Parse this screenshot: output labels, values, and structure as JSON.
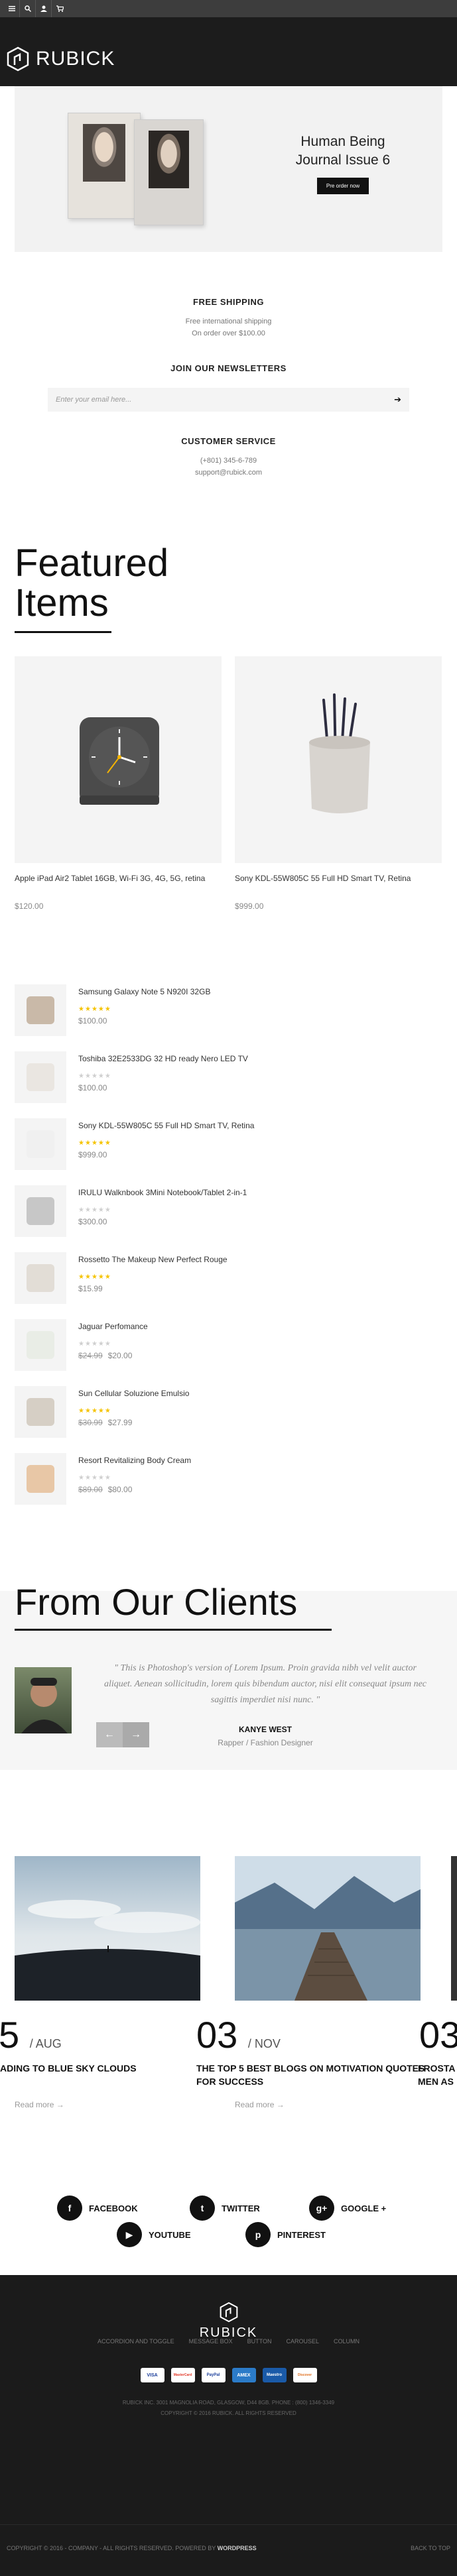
{
  "topbar": {
    "icons": [
      "menu-icon",
      "search-icon",
      "user-icon",
      "cart-icon"
    ]
  },
  "header": {
    "brand": "RUBICK"
  },
  "banner": {
    "title_line1": "Human Being",
    "title_line2": "Journal Issue 6",
    "button": "Pre order now"
  },
  "shipping": {
    "title": "FREE SHIPPING",
    "line1": "Free international shipping",
    "line2": "On order over $100.00"
  },
  "newsletter": {
    "title": "JOIN OUR NEWSLETTERS",
    "placeholder": "Enter your email here..."
  },
  "customer_service": {
    "title": "CUSTOMER SERVICE",
    "phone": "(+801) 345-6-789",
    "email": "support@rubick.com"
  },
  "featured": {
    "title_line1": "Featured",
    "title_line2": "Items",
    "products": [
      {
        "name": "Apple iPad Air2 Tablet 16GB, Wi-Fi 3G, 4G, 5G, retina",
        "price": "$120.00"
      },
      {
        "name": "Sony KDL-55W805C 55 Full HD Smart TV, Retina",
        "price": "$999.00"
      }
    ]
  },
  "product_list": [
    {
      "name": "Samsung Galaxy Note 5 N920I 32GB",
      "rating": 5,
      "price": "$100.00",
      "old_price": ""
    },
    {
      "name": "Toshiba 32E2533DG 32 HD ready Nero LED TV",
      "rating": 0,
      "price": "$100.00",
      "old_price": ""
    },
    {
      "name": "Sony KDL-55W805C 55 Full HD Smart TV, Retina",
      "rating": 5,
      "price": "$999.00",
      "old_price": ""
    },
    {
      "name": "IRULU Walknbook 3Mini Notebook/Tablet 2-in-1",
      "rating": 0,
      "price": "$300.00",
      "old_price": ""
    },
    {
      "name": "Rossetto The Makeup New Perfect Rouge",
      "rating": 5,
      "price": "$15.99",
      "old_price": ""
    },
    {
      "name": "Jaguar Perfomance",
      "rating": 0,
      "price": "$20.00",
      "old_price": "$24.99"
    },
    {
      "name": "Sun Cellular Soluzione Emulsio",
      "rating": 5,
      "price": "$27.99",
      "old_price": "$30.99"
    },
    {
      "name": "Resort Revitalizing Body Cream",
      "rating": 0,
      "price": "$80.00",
      "old_price": "$89.00"
    }
  ],
  "clients": {
    "title": "From Our Clients",
    "quote": "\" This is Photoshop's version  of Lorem Ipsum. Proin gravida nibh vel velit auctor aliquet. Aenean sollicitudin, lorem quis bibendum auctor, nisi elit consequat ipsum nec sagittis imperdiet nisi nunc. \"",
    "author": "KANYE WEST",
    "role": "Rapper / Fashion Designer"
  },
  "blog": [
    {
      "day": "5",
      "month": "/ AUG",
      "title": "ADING TO BLUE SKY CLOUDS",
      "more": "Read more"
    },
    {
      "day": "03",
      "month": "/ NOV",
      "title": "THE TOP 5 BEST BLOGS ON MOTIVATION QUOTES FOR SUCCESS",
      "more": "Read more"
    },
    {
      "day": "03",
      "month": "",
      "title": "FROSTA MEN AS",
      "more": ""
    }
  ],
  "social": {
    "facebook": "FACEBOOK",
    "twitter": "TWITTER",
    "google": "GOOGLE +",
    "youtube": "YOUTUBE",
    "pinterest": "PINTEREST"
  },
  "footer": {
    "brand": "RUBICK",
    "links": [
      "ACCORDION AND TOGGLE",
      "MESSAGE BOX",
      "BUTTON",
      "CAROUSEL",
      "COLUMN"
    ],
    "cards": [
      "VISA",
      "MasterCard",
      "PayPal",
      "AMEX",
      "Maestro",
      "Discover"
    ],
    "address": "RUBICK INC. 3001 MAGNOLIA ROAD, GLASGOW, D44 8GB. PHONE : (800) 1346-3349",
    "copyright_line": "COPYRIGHT © 2016 RUBICK. ALL RIGHTS RESERVED",
    "bottom_left": "COPYRIGHT © 2016 - COMPANY - ALL RIGHTS RESERVED. POWERED BY",
    "bottom_left_brand": "WORDPRESS",
    "back_to_top": "BACK TO TOP"
  }
}
